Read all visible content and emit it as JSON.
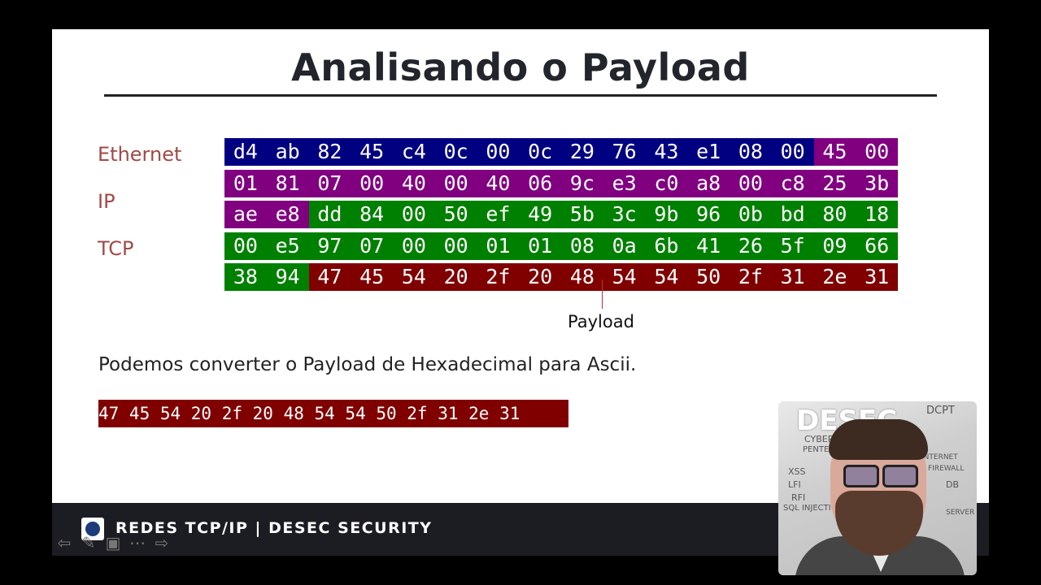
{
  "slide": {
    "title": "Analisando o Payload",
    "labels": {
      "ethernet": "Ethernet",
      "ip": "IP",
      "tcp": "TCP"
    },
    "hex_rows": [
      [
        [
          "d4",
          "eth"
        ],
        [
          "ab",
          "eth"
        ],
        [
          "82",
          "eth"
        ],
        [
          "45",
          "eth"
        ],
        [
          "c4",
          "eth"
        ],
        [
          "0c",
          "eth"
        ],
        [
          "00",
          "eth"
        ],
        [
          "0c",
          "eth"
        ],
        [
          "29",
          "eth"
        ],
        [
          "76",
          "eth"
        ],
        [
          "43",
          "eth"
        ],
        [
          "e1",
          "eth"
        ],
        [
          "08",
          "eth"
        ],
        [
          "00",
          "eth"
        ],
        [
          "45",
          "ip"
        ],
        [
          "00",
          "ip"
        ]
      ],
      [
        [
          "01",
          "ip"
        ],
        [
          "81",
          "ip"
        ],
        [
          "07",
          "ip"
        ],
        [
          "00",
          "ip"
        ],
        [
          "40",
          "ip"
        ],
        [
          "00",
          "ip"
        ],
        [
          "40",
          "ip"
        ],
        [
          "06",
          "ip"
        ],
        [
          "9c",
          "ip"
        ],
        [
          "e3",
          "ip"
        ],
        [
          "c0",
          "ip"
        ],
        [
          "a8",
          "ip"
        ],
        [
          "00",
          "ip"
        ],
        [
          "c8",
          "ip"
        ],
        [
          "25",
          "ip"
        ],
        [
          "3b",
          "ip"
        ]
      ],
      [
        [
          "ae",
          "ip"
        ],
        [
          "e8",
          "ip"
        ],
        [
          "dd",
          "tcp"
        ],
        [
          "84",
          "tcp"
        ],
        [
          "00",
          "tcp"
        ],
        [
          "50",
          "tcp"
        ],
        [
          "ef",
          "tcp"
        ],
        [
          "49",
          "tcp"
        ],
        [
          "5b",
          "tcp"
        ],
        [
          "3c",
          "tcp"
        ],
        [
          "9b",
          "tcp"
        ],
        [
          "96",
          "tcp"
        ],
        [
          "0b",
          "tcp"
        ],
        [
          "bd",
          "tcp"
        ],
        [
          "80",
          "tcp"
        ],
        [
          "18",
          "tcp"
        ]
      ],
      [
        [
          "00",
          "tcp"
        ],
        [
          "e5",
          "tcp"
        ],
        [
          "97",
          "tcp"
        ],
        [
          "07",
          "tcp"
        ],
        [
          "00",
          "tcp"
        ],
        [
          "00",
          "tcp"
        ],
        [
          "01",
          "tcp"
        ],
        [
          "01",
          "tcp"
        ],
        [
          "08",
          "tcp"
        ],
        [
          "0a",
          "tcp"
        ],
        [
          "6b",
          "tcp"
        ],
        [
          "41",
          "tcp"
        ],
        [
          "26",
          "tcp"
        ],
        [
          "5f",
          "tcp"
        ],
        [
          "09",
          "tcp"
        ],
        [
          "66",
          "tcp"
        ]
      ],
      [
        [
          "38",
          "tcp"
        ],
        [
          "94",
          "tcp"
        ],
        [
          "47",
          "pay"
        ],
        [
          "45",
          "pay"
        ],
        [
          "54",
          "pay"
        ],
        [
          "20",
          "pay"
        ],
        [
          "2f",
          "pay"
        ],
        [
          "20",
          "pay"
        ],
        [
          "48",
          "pay"
        ],
        [
          "54",
          "pay"
        ],
        [
          "54",
          "pay"
        ],
        [
          "50",
          "pay"
        ],
        [
          "2f",
          "pay"
        ],
        [
          "31",
          "pay"
        ],
        [
          "2e",
          "pay"
        ],
        [
          "31",
          "pay"
        ]
      ]
    ],
    "payload_label": "Payload",
    "body_text": "Podemos converter o Payload de Hexadecimal para Ascii.",
    "payload_hex": "47 45 54 20 2f 20 48 54 54 50 2f 31 2e 31"
  },
  "colors": {
    "ethernet": "#000080",
    "ip": "#800080",
    "tcp": "#008000",
    "payload": "#800000"
  },
  "footer": {
    "text": "REDES TCP/IP | DESEC SECURITY"
  },
  "nav": {
    "icons": [
      "arrow-left-icon",
      "pencil-icon",
      "screen-icon",
      "more-icon",
      "arrow-right-icon"
    ]
  },
  "webcam": {
    "board_texts": [
      "DESEC",
      "DCPT",
      "CYBER",
      "PENTEST",
      "XSS",
      "LFI",
      "RFI",
      "SQL INJECTION",
      "INTERNET",
      "FIREWALL",
      "DB",
      "SERVER"
    ]
  }
}
